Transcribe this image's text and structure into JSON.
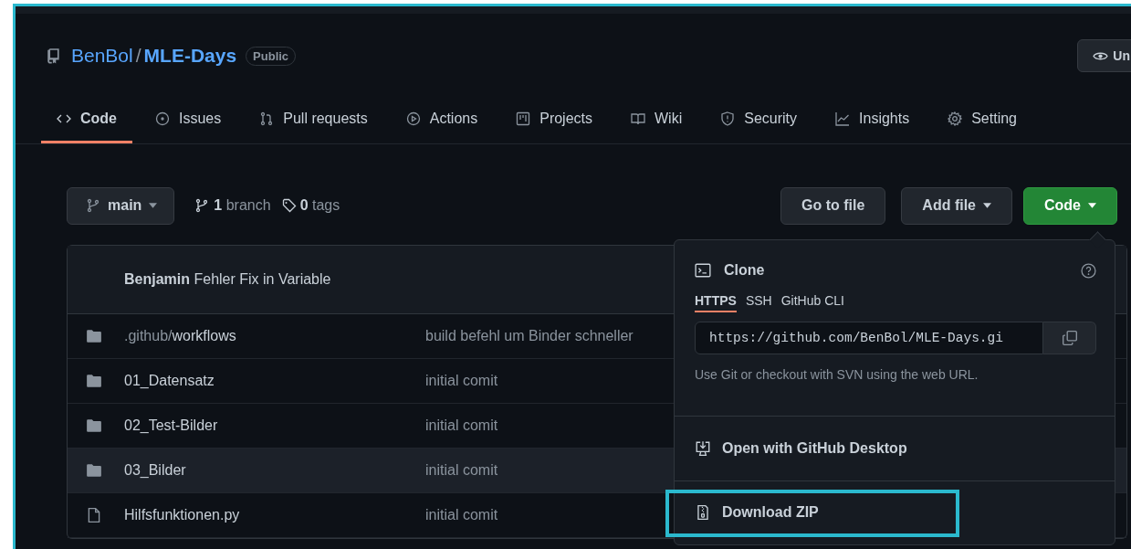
{
  "repo": {
    "owner": "BenBol",
    "name": "MLE-Days",
    "visibility": "Public",
    "separator": "/"
  },
  "watch_button": {
    "label": "Un"
  },
  "tabs": [
    {
      "label": "Code",
      "kind": "code",
      "selected": true
    },
    {
      "label": "Issues",
      "kind": "issues",
      "selected": false
    },
    {
      "label": "Pull requests",
      "kind": "pulls",
      "selected": false
    },
    {
      "label": "Actions",
      "kind": "actions",
      "selected": false
    },
    {
      "label": "Projects",
      "kind": "projects",
      "selected": false
    },
    {
      "label": "Wiki",
      "kind": "wiki",
      "selected": false
    },
    {
      "label": "Security",
      "kind": "security",
      "selected": false
    },
    {
      "label": "Insights",
      "kind": "insights",
      "selected": false
    },
    {
      "label": "Setting",
      "kind": "settings",
      "selected": false
    }
  ],
  "branch_selector": {
    "label": "main"
  },
  "branches": "**1** branch",
  "tags": "**0** tags",
  "buttons": [
    {
      "label": "Go to file",
      "kind": "plain"
    },
    {
      "label": "Add file",
      "kind": "menu"
    },
    {
      "label": "Code",
      "kind": "primary"
    }
  ],
  "latest_commit": "**Benjamin** Fehler Fix in Variable",
  "files": [
    {
      "kind": "folder",
      "prefix": ".github/",
      "name": "workflows",
      "message": "build befehl um Binder schneller",
      "highlighted": false
    },
    {
      "kind": "folder",
      "name": "01_Datensatz",
      "message": "initial comit",
      "highlighted": false
    },
    {
      "kind": "folder",
      "name": "02_Test-Bilder",
      "message": "initial comit",
      "highlighted": false
    },
    {
      "kind": "folder",
      "name": "03_Bilder",
      "message": "initial comit",
      "highlighted": true
    },
    {
      "kind": "file",
      "name": "Hilfsfunktionen.py",
      "message": "initial comit",
      "highlighted": false
    }
  ],
  "clone_menu": {
    "title": "Clone",
    "tabs": [
      {
        "label": "HTTPS",
        "selected": true
      },
      {
        "label": "SSH",
        "selected": false
      },
      {
        "label": "GitHub CLI",
        "selected": false
      }
    ],
    "url": "https://github.com/BenBol/MLE-Days.gi",
    "hint": "Use Git or checkout with SVN using the web URL.",
    "actions": [
      {
        "label": "Open with GitHub Desktop",
        "kind": "desktop",
        "highlighted": false
      },
      {
        "label": "Download ZIP",
        "kind": "zip",
        "highlighted": true
      }
    ]
  }
}
